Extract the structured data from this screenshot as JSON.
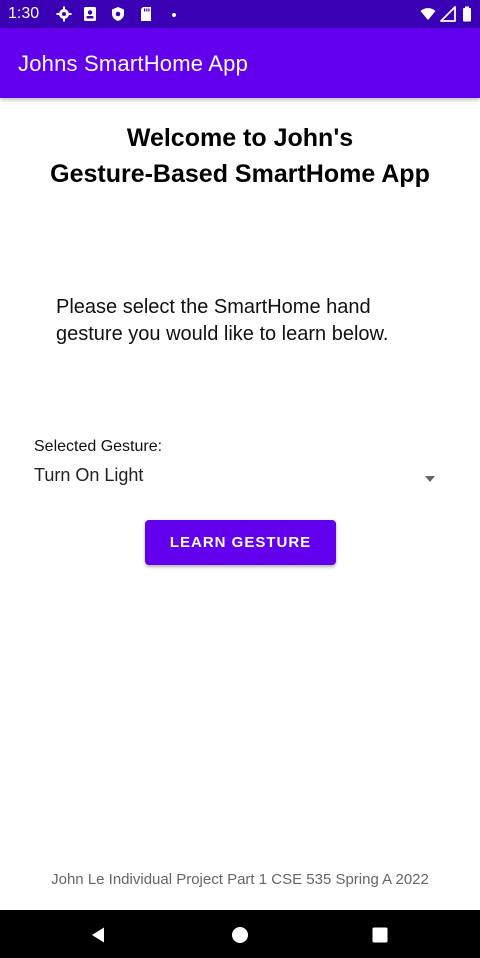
{
  "status_bar": {
    "time": "1:30",
    "left_icons": [
      "settings-icon",
      "contacts-icon",
      "shield-icon",
      "sd-card-icon",
      "dot-icon"
    ],
    "right_icons": [
      "wifi-icon",
      "signal-icon",
      "battery-icon"
    ],
    "background": "#3a00b4"
  },
  "app_bar": {
    "title": "Johns SmartHome App",
    "background": "#6200ee"
  },
  "main": {
    "welcome_line1": "Welcome to John's",
    "welcome_line2": "Gesture-Based SmartHome App",
    "instruction": "Please select the SmartHome hand gesture you would like to learn below.",
    "spinner_label": "Selected Gesture:",
    "spinner_value": "Turn On Light",
    "learn_button_label": "LEARN GESTURE",
    "footer": "John Le Individual Project Part 1 CSE 535 Spring A 2022"
  },
  "nav_bar": {
    "buttons": [
      "back-icon",
      "home-icon",
      "recents-icon"
    ]
  },
  "colors": {
    "accent": "#6200ee",
    "status_bar": "#3a00b4",
    "footer_text": "#666666"
  }
}
